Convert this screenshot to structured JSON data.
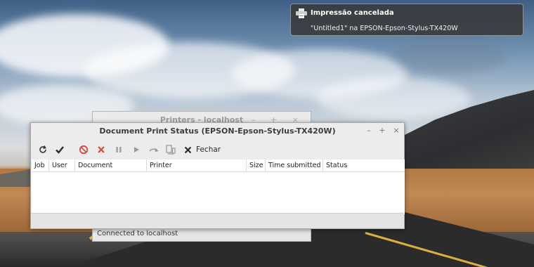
{
  "notification": {
    "title": "Impressão cancelada",
    "body": "\"Untitled1\" na EPSON-Epson-Stylus-TX420W",
    "icon": "printer-icon"
  },
  "background_window": {
    "title": "Printers - localhost",
    "status": "Connected to localhost"
  },
  "window": {
    "title": "Document Print Status (EPSON-Epson-Stylus-TX420W)",
    "controls": {
      "minimize": "–",
      "maximize": "+",
      "close": "×"
    }
  },
  "toolbar": {
    "refresh_icon": "refresh-icon",
    "check_icon": "checkmark-icon",
    "cancel_icon": "cancel-icon",
    "delete_icon": "delete-icon",
    "hold_icon": "pause-icon",
    "release_icon": "play-icon",
    "reprint_icon": "redo-icon",
    "move_icon": "move-job-icon",
    "close_label": "Fechar"
  },
  "table": {
    "columns": [
      "Job",
      "User",
      "Document",
      "Printer",
      "Size",
      "Time submitted",
      "Status"
    ],
    "rows": []
  },
  "colors": {
    "accent_red": "#d94a3a",
    "notify_bg": "#3a3c40"
  }
}
